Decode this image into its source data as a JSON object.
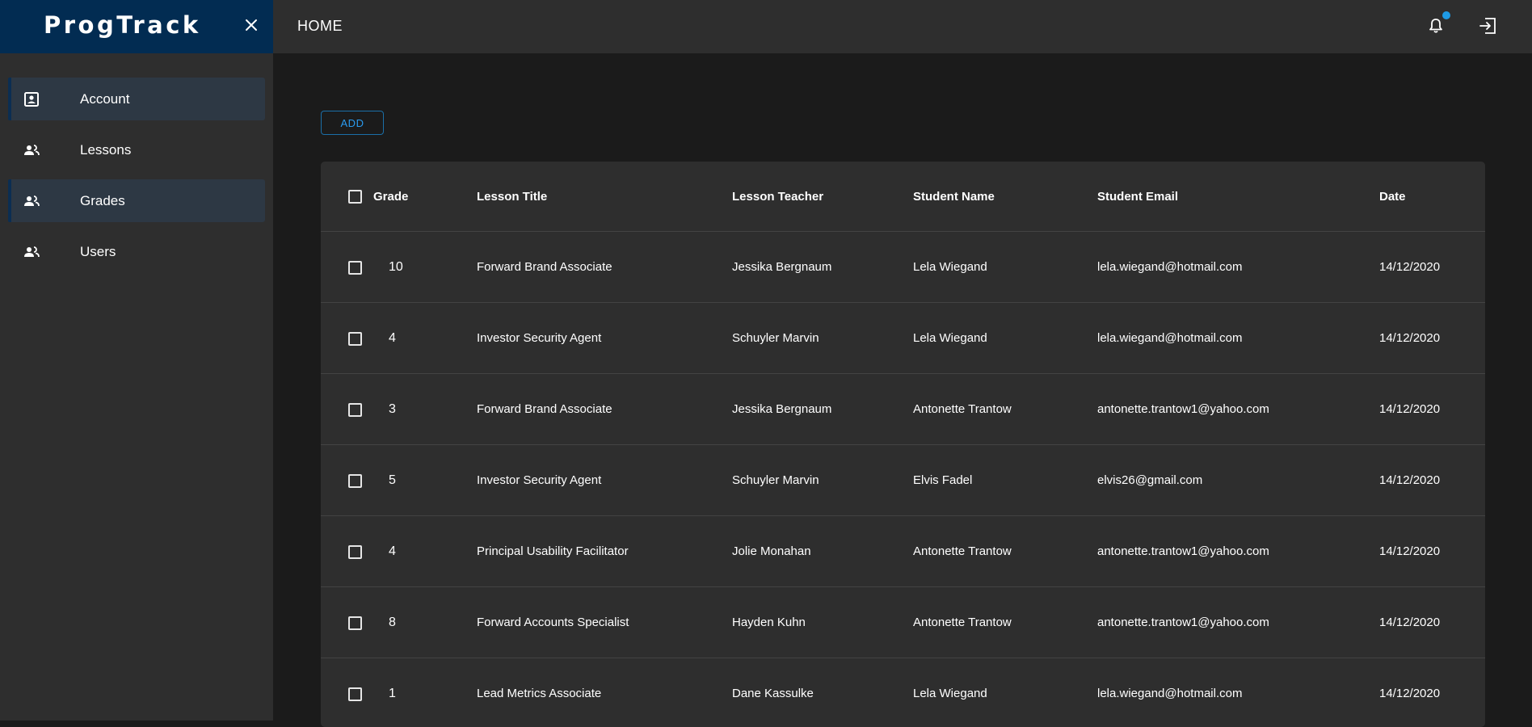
{
  "brand": {
    "title": "ProgTrack"
  },
  "header": {
    "title": "HOME"
  },
  "sidebar": {
    "items": [
      {
        "label": "Account",
        "icon": "account-box-icon",
        "active": true
      },
      {
        "label": "Lessons",
        "icon": "people-icon",
        "active": false
      },
      {
        "label": "Grades",
        "icon": "people-icon",
        "active": true
      },
      {
        "label": "Users",
        "icon": "people-icon",
        "active": false
      }
    ]
  },
  "toolbar": {
    "add_label": "ADD"
  },
  "table": {
    "columns": [
      "Grade",
      "Lesson Title",
      "Lesson Teacher",
      "Student Name",
      "Student Email",
      "Date"
    ],
    "rows": [
      {
        "grade": "10",
        "lesson": "Forward Brand Associate",
        "teacher": "Jessika Bergnaum",
        "student": "Lela Wiegand",
        "email": "lela.wiegand@hotmail.com",
        "date": "14/12/2020"
      },
      {
        "grade": "4",
        "lesson": "Investor Security Agent",
        "teacher": "Schuyler Marvin",
        "student": "Lela Wiegand",
        "email": "lela.wiegand@hotmail.com",
        "date": "14/12/2020"
      },
      {
        "grade": "3",
        "lesson": "Forward Brand Associate",
        "teacher": "Jessika Bergnaum",
        "student": "Antonette Trantow",
        "email": "antonette.trantow1@yahoo.com",
        "date": "14/12/2020"
      },
      {
        "grade": "5",
        "lesson": "Investor Security Agent",
        "teacher": "Schuyler Marvin",
        "student": "Elvis Fadel",
        "email": "elvis26@gmail.com",
        "date": "14/12/2020"
      },
      {
        "grade": "4",
        "lesson": "Principal Usability Facilitator",
        "teacher": "Jolie Monahan",
        "student": "Antonette Trantow",
        "email": "antonette.trantow1@yahoo.com",
        "date": "14/12/2020"
      },
      {
        "grade": "8",
        "lesson": "Forward Accounts Specialist",
        "teacher": "Hayden Kuhn",
        "student": "Antonette Trantow",
        "email": "antonette.trantow1@yahoo.com",
        "date": "14/12/2020"
      },
      {
        "grade": "1",
        "lesson": "Lead Metrics Associate",
        "teacher": "Dane Kassulke",
        "student": "Lela Wiegand",
        "email": "lela.wiegand@hotmail.com",
        "date": "14/12/2020"
      }
    ]
  },
  "colors": {
    "brand_bg": "#022c52",
    "accent": "#2a9bf0",
    "notification_dot": "#1e9be6",
    "active_nav_bg": "#2d3844"
  }
}
